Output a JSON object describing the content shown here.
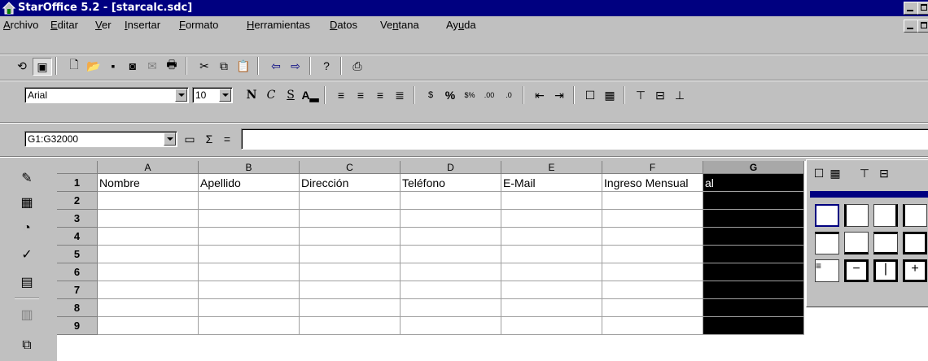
{
  "window": {
    "title": "StarOffice 5.2 - [starcalc.sdc]"
  },
  "menu": [
    {
      "label": "Archivo",
      "u": "A",
      "rest": "rchivo"
    },
    {
      "label": "Editar",
      "u": "E",
      "rest": "ditar"
    },
    {
      "label": "Ver",
      "u": "V",
      "rest": "er"
    },
    {
      "label": "Insertar",
      "u": "I",
      "rest": "nsertar"
    },
    {
      "label": "Formato",
      "u": "F",
      "rest": "ormato"
    },
    {
      "label": "Herramientas",
      "u": "H",
      "rest": "erramientas"
    },
    {
      "label": "Datos",
      "u": "D",
      "rest": "atos"
    },
    {
      "label": "Ventana",
      "pre": "Ve",
      "u": "n",
      "rest": "tana"
    },
    {
      "label": "Ayuda",
      "pre": "Ay",
      "u": "u",
      "rest": "da"
    }
  ],
  "format": {
    "font": "Arial",
    "size": "10",
    "bold": "N",
    "italic": "C",
    "underline": "S"
  },
  "formula": {
    "namebox": "G1:G32000",
    "sum": "Σ",
    "equals": "="
  },
  "sheet": {
    "columns": [
      "A",
      "B",
      "C",
      "D",
      "E",
      "F",
      "G"
    ],
    "rows": [
      "1",
      "2",
      "3",
      "4",
      "5",
      "6",
      "7",
      "8",
      "9"
    ],
    "row1": [
      "Nombre",
      "Apellido",
      "Dirección",
      "Teléfono",
      "E-Mail",
      "Ingreso Mensual",
      "al"
    ],
    "selected_column": "G"
  },
  "colors": {
    "titlebar": "#000080",
    "selection": "#000000",
    "chrome": "#c0c0c0"
  }
}
